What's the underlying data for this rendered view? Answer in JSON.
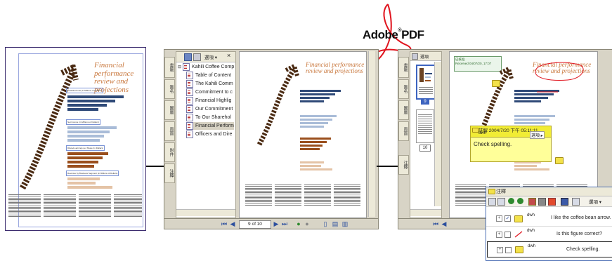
{
  "brand": {
    "name": "Adobe",
    "suffix": "PDF",
    "registered": "®"
  },
  "document": {
    "title_line1": "Financial performance",
    "title_line2": "review and projections",
    "sections": [
      "Total Revenue (in Millions of Dollars)",
      "Net Income (in Millions of Dollars)",
      "Diluted earnings per Share (in Dollars)",
      "Revenue by Business Segment (in Millions of Dollars)"
    ],
    "section_rows": [
      [
        "2001",
        "2000",
        "1999",
        "1998"
      ],
      [
        "2001",
        "2000",
        "1999",
        "1998"
      ],
      [
        "2001",
        "2000",
        "1999",
        "1998"
      ],
      [
        "2001",
        "2000",
        "1999"
      ]
    ]
  },
  "bookmarks_panel": {
    "tabs": [
      "書籤",
      "簽名",
      "圖層",
      "頁面",
      "附件",
      "注釋"
    ],
    "options_label": "選項",
    "close_label": "×",
    "items": [
      "Kahili Coffee Comp",
      "Table of Content",
      "The Kahili Comm",
      "Commitment to c",
      "Financial Highlig",
      "Our Commitment",
      "To Our Sharehol",
      "Financial Perform",
      "Officers and Dire"
    ],
    "selected_index": 7
  },
  "pages_panel": {
    "options_label": "選項",
    "thumb_labels": [
      "9",
      "10"
    ]
  },
  "navigation": {
    "page_display": "9 of 10"
  },
  "stamp": {
    "line1": "已核准",
    "line2": "Received 04/07/20, 17:07"
  },
  "popup_note": {
    "header": "註解  2004/7/20 下午 05:11:11",
    "author": "dwh",
    "options_label": "選項",
    "text": "Check spelling."
  },
  "comments_panel": {
    "title": "注釋",
    "options_label": "選項",
    "rows": [
      {
        "author": "dwh",
        "text": "I like the coffee bean arrow.",
        "checked": true
      },
      {
        "author": "dwh",
        "text": "Is this figure correct?",
        "checked": false
      },
      {
        "author": "dwh",
        "text": "Check spelling.",
        "checked": false
      }
    ]
  },
  "colors": {
    "accent_orange": "#c9793f",
    "bar_navy": "#2f4a78",
    "bar_light": "#a9bcd8",
    "bar_brown": "#9a4f1d",
    "bar_tan": "#e4c3a6",
    "adobe_red": "#e0141e",
    "chrome": "#d8d4c6",
    "note_yellow": "#ffff99"
  }
}
